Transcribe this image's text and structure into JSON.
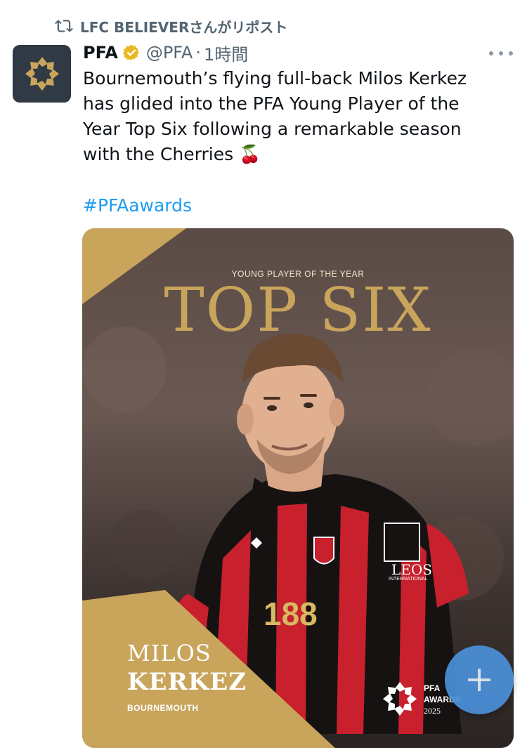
{
  "repost": {
    "text": "LFC BELIEVERさんがリポスト",
    "icon": "repost-icon"
  },
  "author": {
    "name": "PFA",
    "handle": "@PFA",
    "separator": "·",
    "time": "1時間",
    "verified_color": "#e8b923"
  },
  "tweet": {
    "lines": [
      "Bournemouth’s flying full-back Milos Kerkez",
      "has glided into the PFA Young Player of the",
      "Year Top Six following a remarkable season",
      "with the Cherries 🍒"
    ],
    "hashtag": "#PFAawards"
  },
  "card": {
    "kicker": "YOUNG PLAYER OF THE YEAR",
    "headline": "TOP SIX",
    "first_name": "MILOS",
    "last_name": "KERKEZ",
    "club": "BOURNEMOUTH",
    "sponsor": "188",
    "kit_brand": "LEOS",
    "kit_brand_sub": "INTERNATIONAL",
    "awards_logo": [
      "PFA",
      "AWARDS",
      "2025"
    ],
    "gold": "#c9a55c"
  },
  "colors": {
    "link": "#1d9bf0",
    "muted": "#536471",
    "fab": "#4a90d9"
  }
}
